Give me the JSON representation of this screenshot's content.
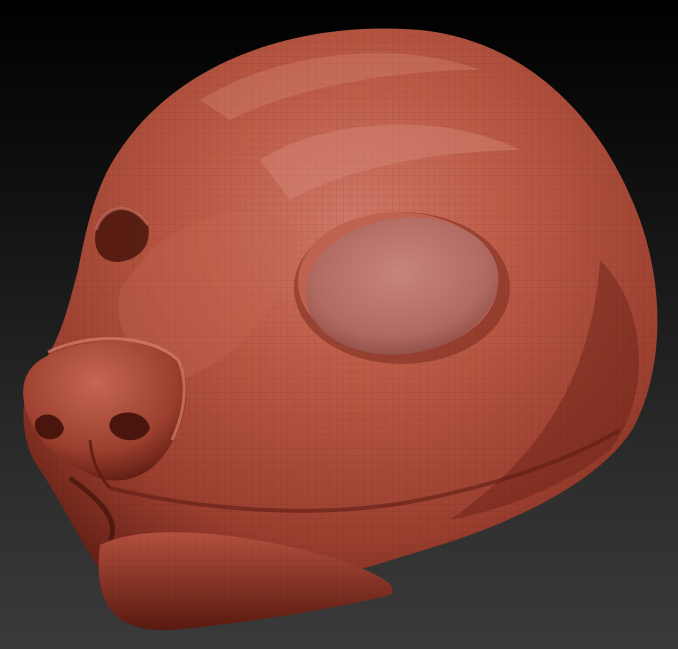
{
  "scene": {
    "subject": "sculpted-animal-head-mask",
    "colors": {
      "background_top": "#000000",
      "background_bottom": "#3a3a3a",
      "clay_base": "#b4503e",
      "clay_light": "#d48272",
      "clay_shadow": "#6e2418",
      "clay_deep_shadow": "#4a150c",
      "eye_socket": "#b06a62",
      "eye_highlight": "#c8857c"
    }
  }
}
